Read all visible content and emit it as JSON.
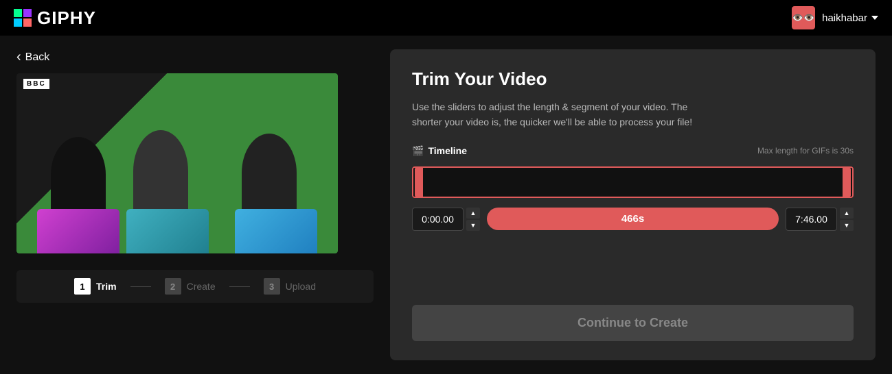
{
  "header": {
    "logo_text": "GIPHY",
    "avatar_text": "😶",
    "username": "haikhabar",
    "chevron_icon": "chevron-down"
  },
  "left_panel": {
    "back_label": "Back",
    "steps": [
      {
        "number": "1",
        "label": "Trim",
        "active": true
      },
      {
        "number": "2",
        "label": "Create",
        "active": false
      },
      {
        "number": "3",
        "label": "Upload",
        "active": false
      }
    ]
  },
  "right_panel": {
    "title": "Trim Your Video",
    "description": "Use the sliders to adjust the length & segment of your video. The shorter your video is, the quicker we'll be able to process your file!",
    "timeline_label": "Timeline",
    "max_length_text": "Max length for GIFs is 30s",
    "start_time": "0:00.00",
    "duration": "466s",
    "end_time": "7:46.00",
    "continue_button": "Continue to Create"
  },
  "bbc_label": "BBC"
}
